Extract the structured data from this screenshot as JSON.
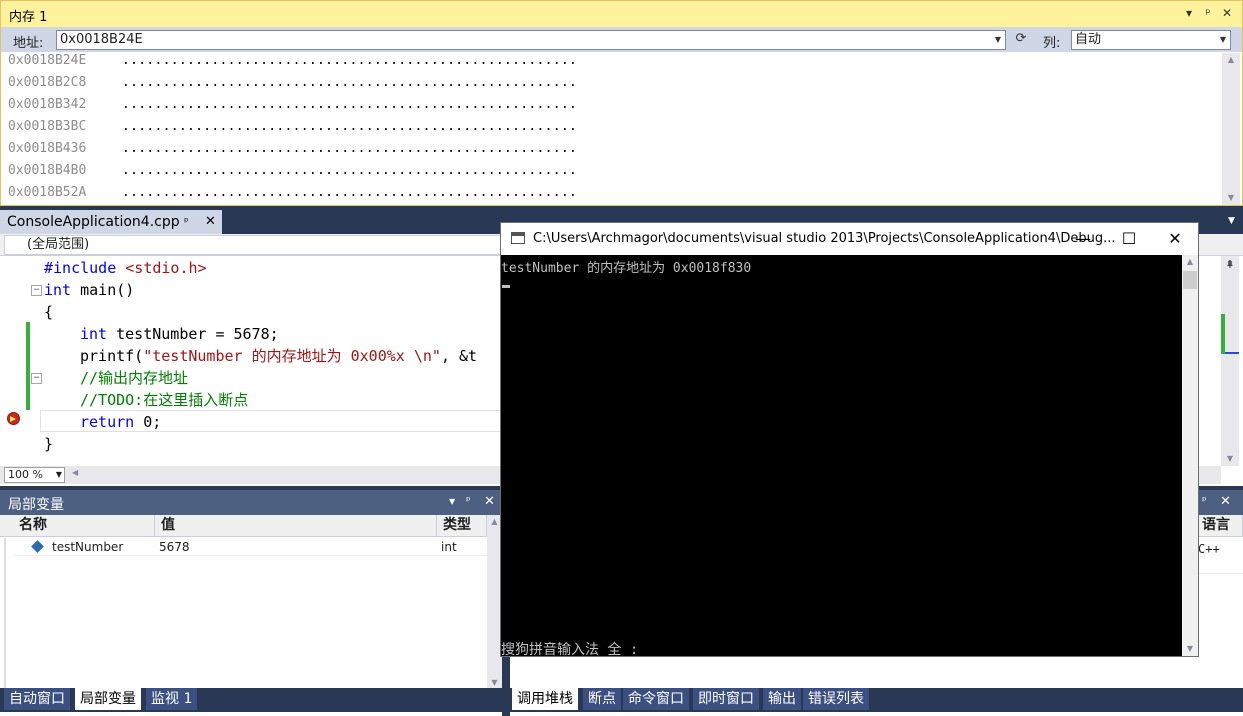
{
  "memory_window": {
    "title": "内存 1",
    "buttons": [
      "▾",
      "ᵖ",
      "✕"
    ],
    "address_label": "地址:",
    "address_value": "0x0018B24E",
    "columns_label": "列:",
    "columns_value": "自动",
    "rows": [
      {
        "address": "0x0018B24E",
        "data": "........................................................"
      },
      {
        "address": "0x0018B2C8",
        "data": "........................................................"
      },
      {
        "address": "0x0018B342",
        "data": "........................................................"
      },
      {
        "address": "0x0018B3BC",
        "data": "........................................................"
      },
      {
        "address": "0x0018B436",
        "data": "........................................................"
      },
      {
        "address": "0x0018B4B0",
        "data": "........................................................"
      },
      {
        "address": "0x0018B52A",
        "data": "........................................................"
      }
    ]
  },
  "editor": {
    "tab_name": "ConsoleApplication4.cpp",
    "scope": "(全局范围)",
    "zoom": "100 %",
    "code": {
      "l1_pp": "#include",
      "l1_hdr": " <stdio.h>",
      "l2_kw": "int",
      "l2_rest": " main()",
      "l3": "{",
      "l4_kw": "int",
      "l4_rest": " testNumber = 5678;",
      "l5_fn": "printf(",
      "l5_str": "\"testNumber 的内存地址为 0x00%x \\n\"",
      "l5_rest": ", &t",
      "l6": "//输出内存地址",
      "l7": "//TODO:在这里插入断点",
      "l8_kw": "return",
      "l8_rest": " 0;",
      "l9": "}"
    }
  },
  "locals": {
    "title": "局部变量",
    "columns": [
      "名称",
      "值",
      "类型"
    ],
    "row": {
      "name": "testNumber",
      "value": "5678",
      "type": "int"
    },
    "tabs": [
      "自动窗口",
      "局部变量",
      "监视 1"
    ]
  },
  "right_panel": {
    "header_fragment": "语言",
    "cell_fragment": "C++",
    "tabs": [
      "调用堆栈",
      "断点",
      "命令窗口",
      "即时窗口",
      "输出",
      "错误列表"
    ]
  },
  "console": {
    "title": "C:\\Users\\Archmagor\\documents\\visual studio 2013\\Projects\\ConsoleApplication4\\Debug...",
    "output_line": "testNumber 的内存地址为 0x0018f830",
    "ime_status": "搜狗拼音输入法 全 :",
    "buttons": [
      "—",
      "☐",
      "✕"
    ]
  },
  "colors": {
    "background": "#293955",
    "memory_title": "#fff29d",
    "panel_title": "#4d6082",
    "keyword": "#0000ff",
    "string": "#a31515",
    "comment": "#008000",
    "change_bar": "#33b13a"
  }
}
